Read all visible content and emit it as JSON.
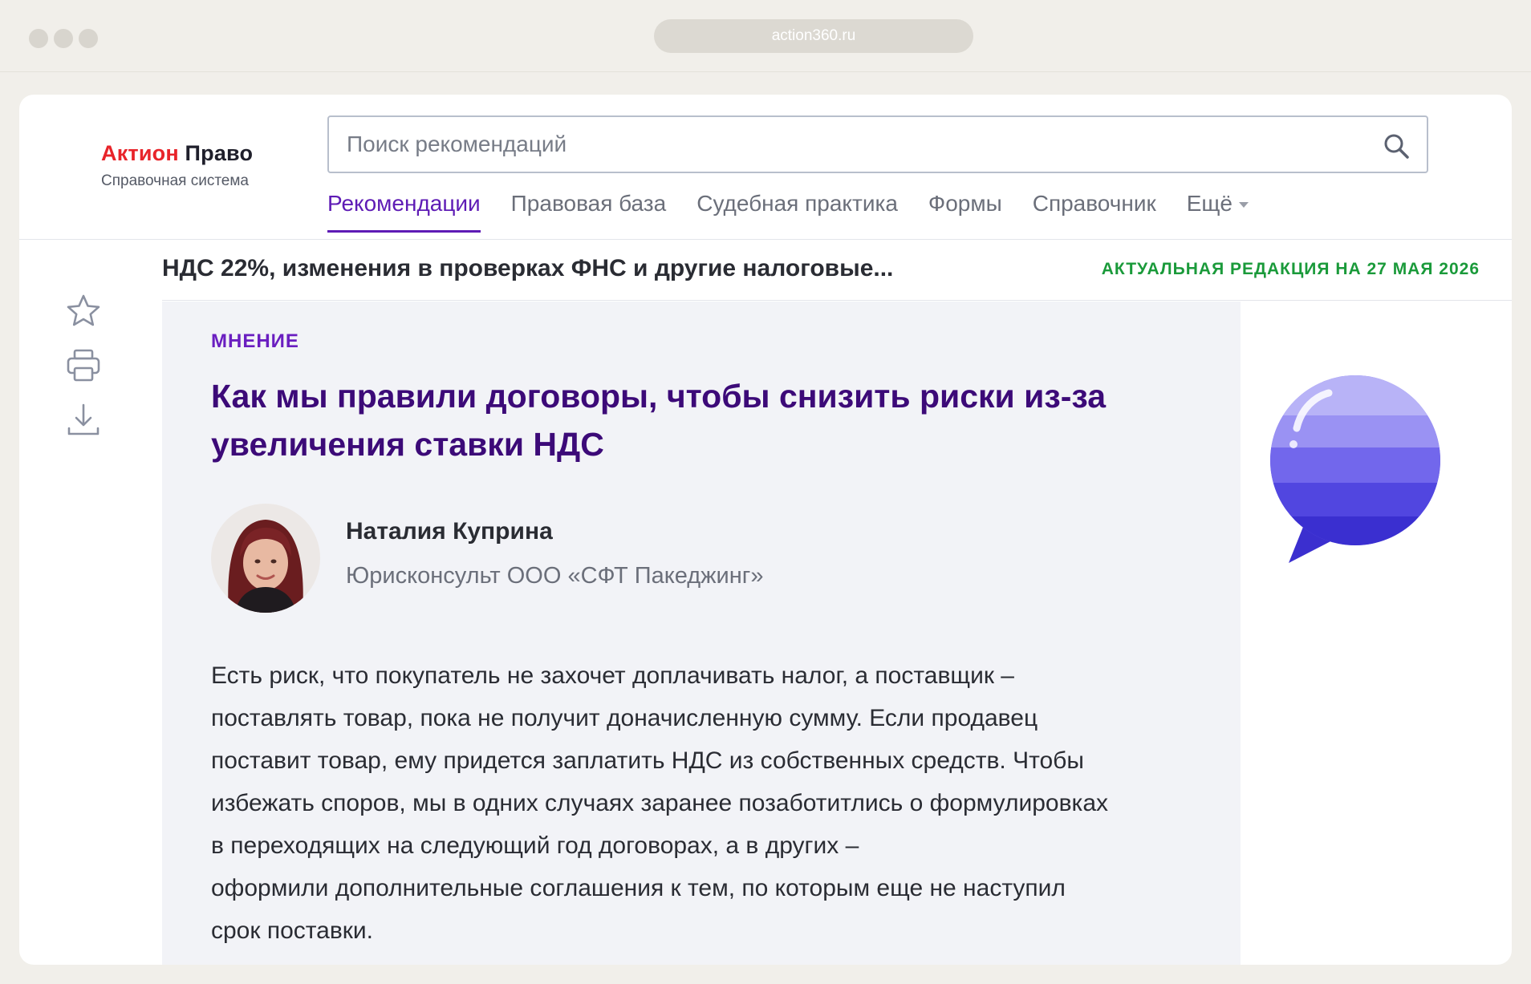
{
  "browser": {
    "url": "action360.ru"
  },
  "header": {
    "logo_brand_red": "Актион",
    "logo_brand_dark": "Право",
    "logo_subtitle": "Справочная система",
    "search_placeholder": "Поиск рекомендаций",
    "tabs": [
      {
        "label": "Рекомендации",
        "active": true
      },
      {
        "label": "Правовая база",
        "active": false
      },
      {
        "label": "Судебная практика",
        "active": false
      },
      {
        "label": "Формы",
        "active": false
      },
      {
        "label": "Справочник",
        "active": false
      },
      {
        "label": "Ещё",
        "active": false
      }
    ]
  },
  "document": {
    "title": "НДС 22%, изменения в проверках ФНС и другие налоговые...",
    "edition": "АКТУАЛЬНАЯ РЕДАКЦИЯ НА 27 МАЯ 2026"
  },
  "toolbar": {
    "icons": [
      "star-icon",
      "print-icon",
      "download-icon"
    ]
  },
  "article": {
    "tag": "МНЕНИЕ",
    "headline": "Как мы правили договоры, чтобы снизить риски из-за увеличения ставки НДС",
    "author_name": "Наталия Куприна",
    "author_role": "Юрисконсульт ООО «СФТ Пакеджинг»",
    "body": "Есть риск, что покупатель не захочет доплачивать налог, а поставщик –\nпоставлять товар, пока не получит доначисленную сумму. Если продавец\nпоставит товар, ему придется заплатить НДС из собственных средств. Чтобы\nизбежать споров, мы в одних случаях заранее позаботитлись о формулировках\nв переходящих на следующий год договорах, а в других –\n оформили дополнительные соглашения к тем, по которым еще не наступил\nсрок поставки."
  },
  "colors": {
    "accent_purple": "#5e1bb5",
    "headline_purple": "#3c0a78",
    "edition_green": "#1a9a3a",
    "logo_red": "#e8242a"
  }
}
